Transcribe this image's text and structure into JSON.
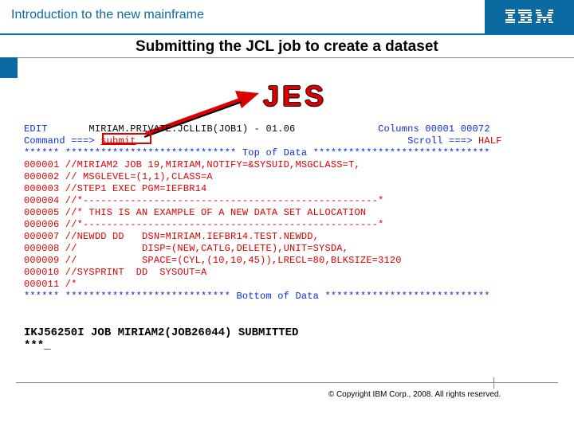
{
  "header": {
    "course_title": "Introduction to the new mainframe",
    "logo_text": "IBM"
  },
  "slide": {
    "title": "Submitting the JCL job to create a dataset",
    "callout_label": "JES"
  },
  "terminal": {
    "edit_label": "EDIT",
    "dataset": "MIRIAM.PRIVATE.JCLLIB(JOB1) - 01.06",
    "columns_label": "Columns 00001 00072",
    "command_label": "Command ===>",
    "command_value": "submit",
    "scroll_label": "Scroll ===>",
    "scroll_value": "HALF",
    "top_ruler": "****** ***************************** Top of Data ******************************",
    "lines": [
      "000001 //MIRIAM2 JOB 19,MIRIAM,NOTIFY=&SYSUID,MSGCLASS=T,",
      "000002 // MSGLEVEL=(1,1),CLASS=A",
      "000003 //STEP1 EXEC PGM=IEFBR14",
      "000004 //*--------------------------------------------------*",
      "000005 //* THIS IS AN EXAMPLE OF A NEW DATA SET ALLOCATION",
      "000006 //*--------------------------------------------------*",
      "000007 //NEWDD DD   DSN=MIRIAM.IEFBR14.TEST.NEWDD,",
      "000008 //           DISP=(NEW,CATLG,DELETE),UNIT=SYSDA,",
      "000009 //           SPACE=(CYL,(10,10,45)),LRECL=80,BLKSIZE=3120",
      "000010 //SYSPRINT  DD  SYSOUT=A",
      "000011 /*"
    ],
    "bottom_ruler": "****** **************************** Bottom of Data ****************************"
  },
  "result": {
    "line1": "IKJ56250I JOB MIRIAM2(JOB26044) SUBMITTED",
    "line2": "***_"
  },
  "footer": {
    "copyright": "© Copyright IBM Corp., 2008. All rights reserved."
  }
}
